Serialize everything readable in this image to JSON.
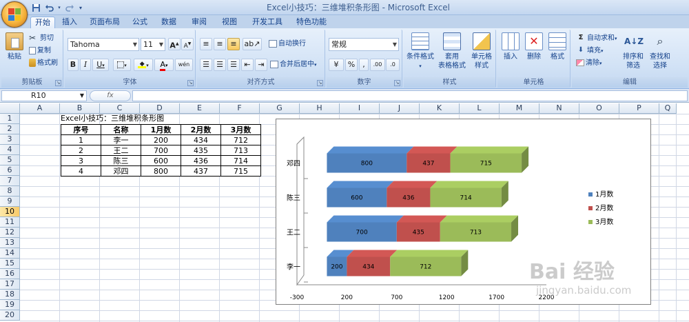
{
  "window": {
    "title": "Excel小技巧：三维堆积条形图 - Microsoft Excel"
  },
  "quick_access": {
    "save_icon": "save-icon",
    "undo_icon": "undo-icon",
    "redo_icon": "redo-icon",
    "dropdown_icon": "chevron-down-icon"
  },
  "tabs": [
    {
      "label": "开始",
      "active": true
    },
    {
      "label": "插入"
    },
    {
      "label": "页面布局"
    },
    {
      "label": "公式"
    },
    {
      "label": "数据"
    },
    {
      "label": "审阅"
    },
    {
      "label": "视图"
    },
    {
      "label": "开发工具"
    },
    {
      "label": "特色功能"
    }
  ],
  "ribbon": {
    "clipboard": {
      "label": "剪贴板",
      "paste": "粘贴",
      "cut": "剪切",
      "copy": "复制",
      "format_painter": "格式刷"
    },
    "font": {
      "label": "字体",
      "font_name": "Tahoma",
      "font_size": "11",
      "bold": "B",
      "italic": "I",
      "underline": "U",
      "grow": "A",
      "shrink": "A",
      "phonetic": "wén"
    },
    "alignment": {
      "label": "对齐方式",
      "wrap": "自动换行",
      "merge": "合并后居中"
    },
    "number": {
      "label": "数字",
      "format": "常规",
      "percent": "%",
      "comma": ",",
      "inc_decimal": ".00",
      "dec_decimal": ".0"
    },
    "styles": {
      "label": "样式",
      "conditional": "条件格式",
      "table_format_1": "套用",
      "table_format_2": "表格格式",
      "cell_style_1": "单元格",
      "cell_style_2": "样式"
    },
    "cells": {
      "label": "单元格",
      "insert": "插入",
      "delete": "删除",
      "format": "格式"
    },
    "editing": {
      "label": "编辑",
      "autosum": "自动求和",
      "fill": "填充",
      "clear": "清除",
      "sort_1": "排序和",
      "sort_2": "筛选",
      "find_1": "查找和",
      "find_2": "选择"
    }
  },
  "formula_bar": {
    "name_box": "R10",
    "fx": "fx",
    "content": ""
  },
  "columns": [
    "A",
    "B",
    "C",
    "D",
    "E",
    "F",
    "G",
    "H",
    "I",
    "J",
    "K",
    "L",
    "M",
    "N",
    "O",
    "P",
    "Q"
  ],
  "rows": [
    "1",
    "2",
    "3",
    "4",
    "5",
    "6",
    "7",
    "8",
    "9",
    "10",
    "11",
    "12",
    "13",
    "14",
    "15",
    "16",
    "17",
    "18",
    "19",
    "20"
  ],
  "selected_row": "10",
  "sheet": {
    "title_cell": "Excel小技巧：三维堆积条形图",
    "headers": [
      "序号",
      "名称",
      "1月数",
      "2月数",
      "3月数"
    ],
    "rows": [
      [
        "1",
        "李一",
        "200",
        "434",
        "712"
      ],
      [
        "2",
        "王二",
        "700",
        "435",
        "713"
      ],
      [
        "3",
        "陈三",
        "600",
        "436",
        "714"
      ],
      [
        "4",
        "邓四",
        "800",
        "437",
        "715"
      ]
    ]
  },
  "chart_data": {
    "type": "bar",
    "subtype": "3d-stacked-horizontal",
    "categories": [
      "李一",
      "王二",
      "陈三",
      "邓四"
    ],
    "series": [
      {
        "name": "1月数",
        "values": [
          200,
          700,
          600,
          800
        ],
        "color": "#4f81bd"
      },
      {
        "name": "2月数",
        "values": [
          434,
          435,
          436,
          437
        ],
        "color": "#c0504d"
      },
      {
        "name": "3月数",
        "values": [
          712,
          713,
          714,
          715
        ],
        "color": "#9bbb59"
      }
    ],
    "x_ticks": [
      "-300",
      "200",
      "700",
      "1200",
      "1700",
      "2200"
    ],
    "xlim": [
      -300,
      2200
    ],
    "legend": "right",
    "grid": false
  },
  "watermark": {
    "line1": "Bai 经验",
    "line2": "jingyan.baidu.com"
  }
}
